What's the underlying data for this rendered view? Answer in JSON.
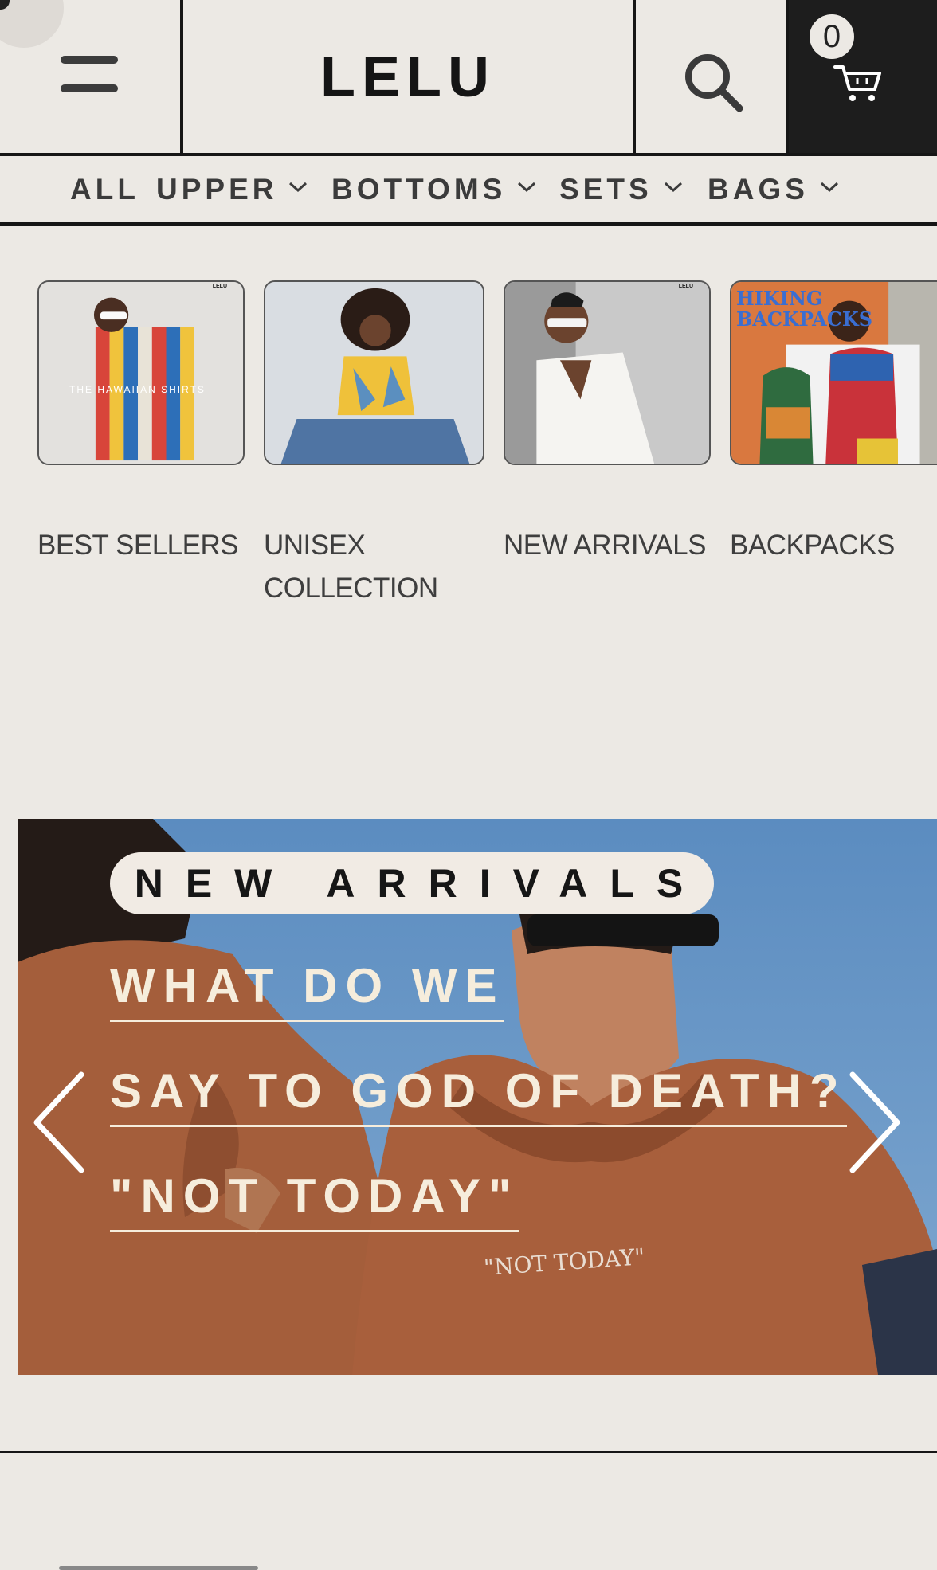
{
  "header": {
    "logo": "LELU",
    "cart_count": "0",
    "menu_icon": "hamburger-icon",
    "search_icon": "search-icon",
    "cart_icon": "shopping-cart-icon"
  },
  "catnav": {
    "items": [
      {
        "label": "ALL",
        "has_dropdown": false
      },
      {
        "label": "UPPER",
        "has_dropdown": true
      },
      {
        "label": "BOTTOMS",
        "has_dropdown": true
      },
      {
        "label": "SETS",
        "has_dropdown": true
      },
      {
        "label": "BAGS",
        "has_dropdown": true
      }
    ]
  },
  "collections": [
    {
      "label": "BEST SELLERS",
      "image_text": "THE HAWAIIAN SHIRTS",
      "brand": "LELU"
    },
    {
      "label": "UNISEX\nCOLLECTION"
    },
    {
      "label": "NEW ARRIVALS",
      "brand": "LELU"
    },
    {
      "label": "BACKPACKS",
      "image_text": "HIKING BACKPACKS"
    }
  ],
  "banner": {
    "pill": "NEW ARRIVALS",
    "lines": [
      "WHAT DO WE",
      "SAY TO GOD OF DEATH?",
      "\"NOT TODAY\""
    ],
    "hoodie_text": "\"NOT TODAY\""
  },
  "colors": {
    "background": "#ece9e4",
    "ink": "#161616",
    "cart_bg": "#1d1d1d",
    "hoodie": "#a9603c",
    "sky": "#5f8fbf"
  }
}
